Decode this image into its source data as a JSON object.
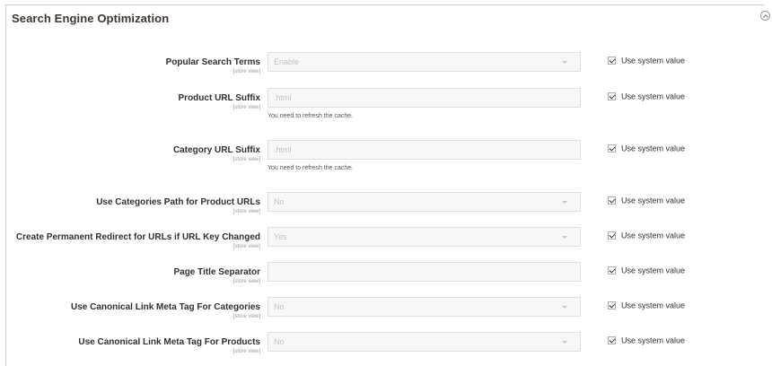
{
  "section": {
    "title": "Search Engine Optimization",
    "collapse_icon": "collapse-up-icon"
  },
  "rows": [
    {
      "label": "Popular Search Terms",
      "scope": "[store view]",
      "type": "select",
      "value": "Enable",
      "note": "",
      "system_value_label": "Use system value",
      "use_system_value": true
    },
    {
      "label": "Product URL Suffix",
      "scope": "[store view]",
      "type": "text",
      "value": ".html",
      "note": "You need to refresh the cache.",
      "system_value_label": "Use system value",
      "use_system_value": true
    },
    {
      "label": "Category URL Suffix",
      "scope": "[store view]",
      "type": "text",
      "value": ".html",
      "note": "You need to refresh the cache.",
      "system_value_label": "Use system value",
      "use_system_value": true
    },
    {
      "label": "Use Categories Path for Product URLs",
      "scope": "[store view]",
      "type": "select",
      "value": "No",
      "note": "",
      "system_value_label": "Use system value",
      "use_system_value": true
    },
    {
      "label": "Create Permanent Redirect for URLs if URL Key Changed",
      "scope": "[store view]",
      "type": "select",
      "value": "Yes",
      "note": "",
      "system_value_label": "Use system value",
      "use_system_value": true
    },
    {
      "label": "Page Title Separator",
      "scope": "[store view]",
      "type": "text",
      "value": "",
      "note": "",
      "system_value_label": "Use system value",
      "use_system_value": true
    },
    {
      "label": "Use Canonical Link Meta Tag For Categories",
      "scope": "[store view]",
      "type": "select",
      "value": "No",
      "note": "",
      "system_value_label": "Use system value",
      "use_system_value": true
    },
    {
      "label": "Use Canonical Link Meta Tag For Products",
      "scope": "[store view]",
      "type": "select",
      "value": "No",
      "note": "",
      "system_value_label": "Use system value",
      "use_system_value": true
    }
  ]
}
